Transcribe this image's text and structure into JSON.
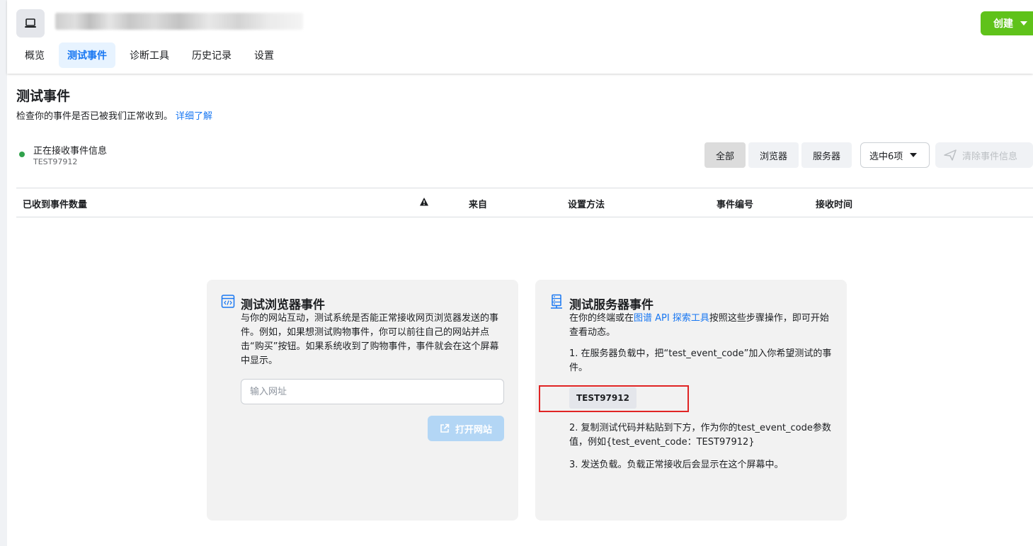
{
  "header": {
    "create_label": "创建"
  },
  "tabs": [
    {
      "label": "概览",
      "active": false
    },
    {
      "label": "测试事件",
      "active": true
    },
    {
      "label": "诊断工具",
      "active": false
    },
    {
      "label": "历史记录",
      "active": false
    },
    {
      "label": "设置",
      "active": false
    }
  ],
  "page": {
    "title": "测试事件",
    "subtitle": "检查你的事件是否已被我们正常收到。",
    "learn_more": "详细了解"
  },
  "status": {
    "text": "正在接收事件信息",
    "code": "TEST97912",
    "dot_color": "#31a24c"
  },
  "filters": {
    "segments": [
      "全部",
      "浏览器",
      "服务器"
    ],
    "select_label": "选中6项",
    "clear_label": "清除事件信息"
  },
  "table": {
    "columns": [
      "已收到事件数量",
      "来自",
      "设置方法",
      "事件编号",
      "接收时间"
    ]
  },
  "browser_card": {
    "icon": "code-window-icon",
    "title": "测试浏览器事件",
    "description": "与你的网站互动，测试系统是否能正常接收网页浏览器发送的事件。例如，如果想测试购物事件，你可以前往自己的网站并点击“购买”按钮。如果系统收到了购物事件，事件就会在这个屏幕中显示。",
    "input_placeholder": "输入网址",
    "open_label": "打开网站"
  },
  "server_card": {
    "icon": "server-icon",
    "title": "测试服务器事件",
    "desc_prefix": "在你的终端或在",
    "desc_link": "图谱 API 探索工具",
    "desc_suffix": "按照这些步骤操作，即可开始查看动态。",
    "step1": "1. 在服务器负载中，把“test_event_code”加入你希望测试的事件。",
    "code": "TEST97912",
    "step2": "2. 复制测试代码并粘贴到下方，作为你的test_event_code参数值，例如{test_event_code：TEST97912}",
    "step3": "3. 发送负载。负载正常接收后会显示在这个屏幕中。"
  },
  "colors": {
    "accent": "#1877f2",
    "create_green": "#5fc21a",
    "highlight_red": "#e02424"
  }
}
